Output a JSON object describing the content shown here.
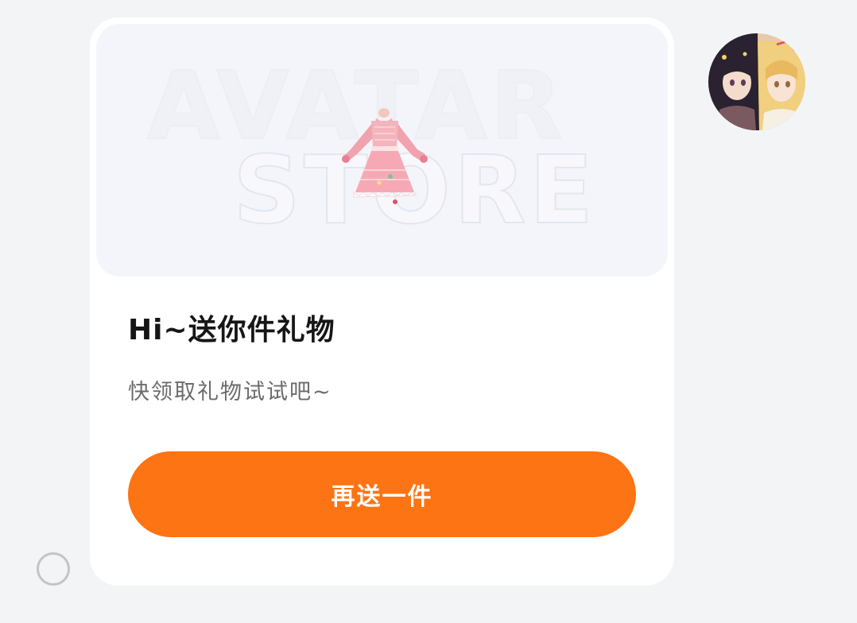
{
  "banner": {
    "watermark_line1": "AVATAR",
    "watermark_line2": "STORE",
    "image_icon": "dress-icon"
  },
  "message": {
    "title": "Hi~送你件礼物",
    "subtitle": "快领取礼物试试吧~"
  },
  "action": {
    "label": "再送一件"
  },
  "avatar": {
    "icon": "avatar-icon"
  },
  "selection": {
    "icon": "radio-circle-icon",
    "selected": false
  },
  "colors": {
    "page_bg": "#f3f4f6",
    "card_bg": "#ffffff",
    "banner_bg": "#f4f5fa",
    "accent": "#fd7414",
    "title": "#161616",
    "subtitle": "#6b6b6b"
  }
}
